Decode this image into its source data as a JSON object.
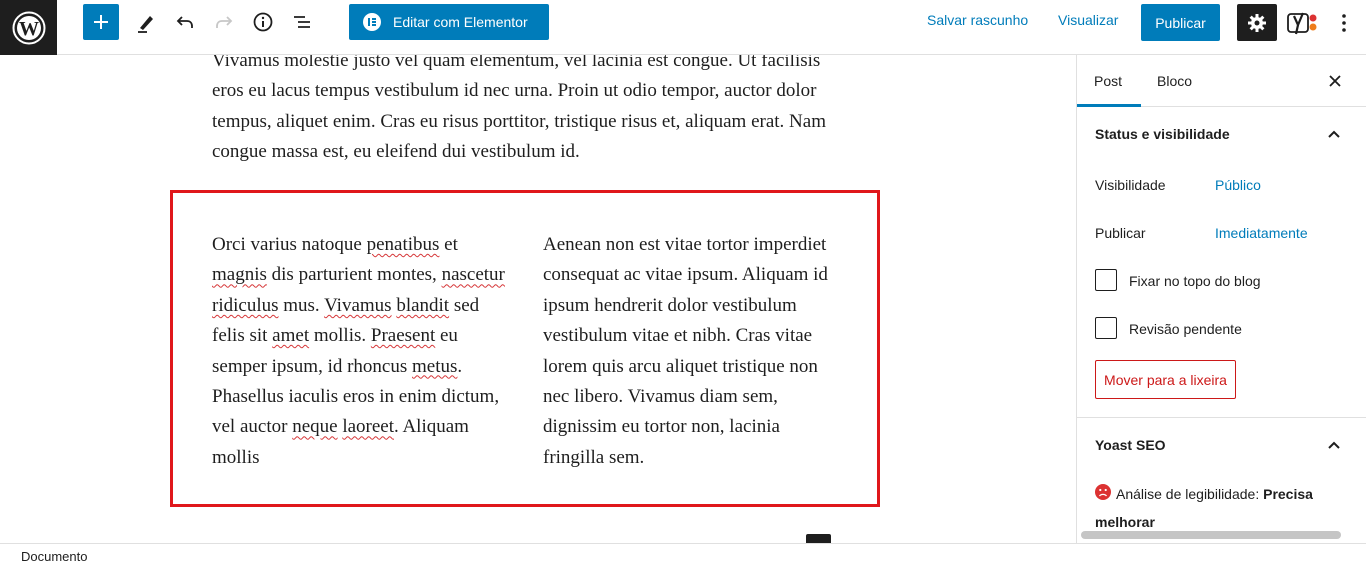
{
  "toolbar": {
    "elementor_label": "Editar com Elementor",
    "save_draft": "Salvar rascunho",
    "preview": "Visualizar",
    "publish": "Publicar",
    "colors": {
      "accent": "#007cba",
      "dark": "#1e1e1e"
    }
  },
  "editor": {
    "para_top": "Vivamus molestie justo vel quam elementum, vel lacinia est congue. Ut facilisis eros eu lacus tempus vestibulum id nec urna. Proin ut odio tempor, auctor dolor tempus, aliquet enim. Cras eu risus porttitor, tristique risus et, aliquam erat. Nam congue massa est, eu eleifend dui vestibulum id.",
    "col_left": [
      "Orci varius natoque ",
      "penatibus",
      " et ",
      "magnis",
      " dis parturient montes, ",
      "nascetur",
      " ",
      "ridiculus",
      " mus. ",
      "Vivamus",
      " ",
      "blandit",
      " sed felis sit ",
      "amet",
      " mollis. ",
      "Praesent",
      " eu semper ipsum, id rhoncus ",
      "metus",
      ". Phasellus iaculis eros in enim dictum, vel auctor ",
      "neque",
      " ",
      "laoreet",
      ". Aliquam mollis"
    ],
    "col_right": "Aenean non est vitae tortor imperdiet consequat ac vitae ipsum. Aliquam id ipsum hendrerit dolor vestibulum vestibulum vitae et nibh. Cras vitae lorem quis arcu aliquet tristique non nec libero. Vivamus diam sem, dignissim eu tortor non, lacinia fringilla sem.",
    "highlight_color": "#e0171b"
  },
  "sidebar": {
    "tabs": [
      "Post",
      "Bloco"
    ],
    "status_panel": {
      "title": "Status e visibilidade",
      "visibility_label": "Visibilidade",
      "visibility_value": "Público",
      "publish_label": "Publicar",
      "publish_value": "Imediatamente",
      "sticky_label": "Fixar no topo do blog",
      "pending_label": "Revisão pendente",
      "trash_label": "Mover para a lixeira"
    },
    "yoast_panel": {
      "title": "Yoast SEO",
      "readability_label": "Análise de legibilidade: ",
      "readability_value": "Precisa melhorar"
    }
  },
  "footer": {
    "breadcrumb": "Documento"
  }
}
